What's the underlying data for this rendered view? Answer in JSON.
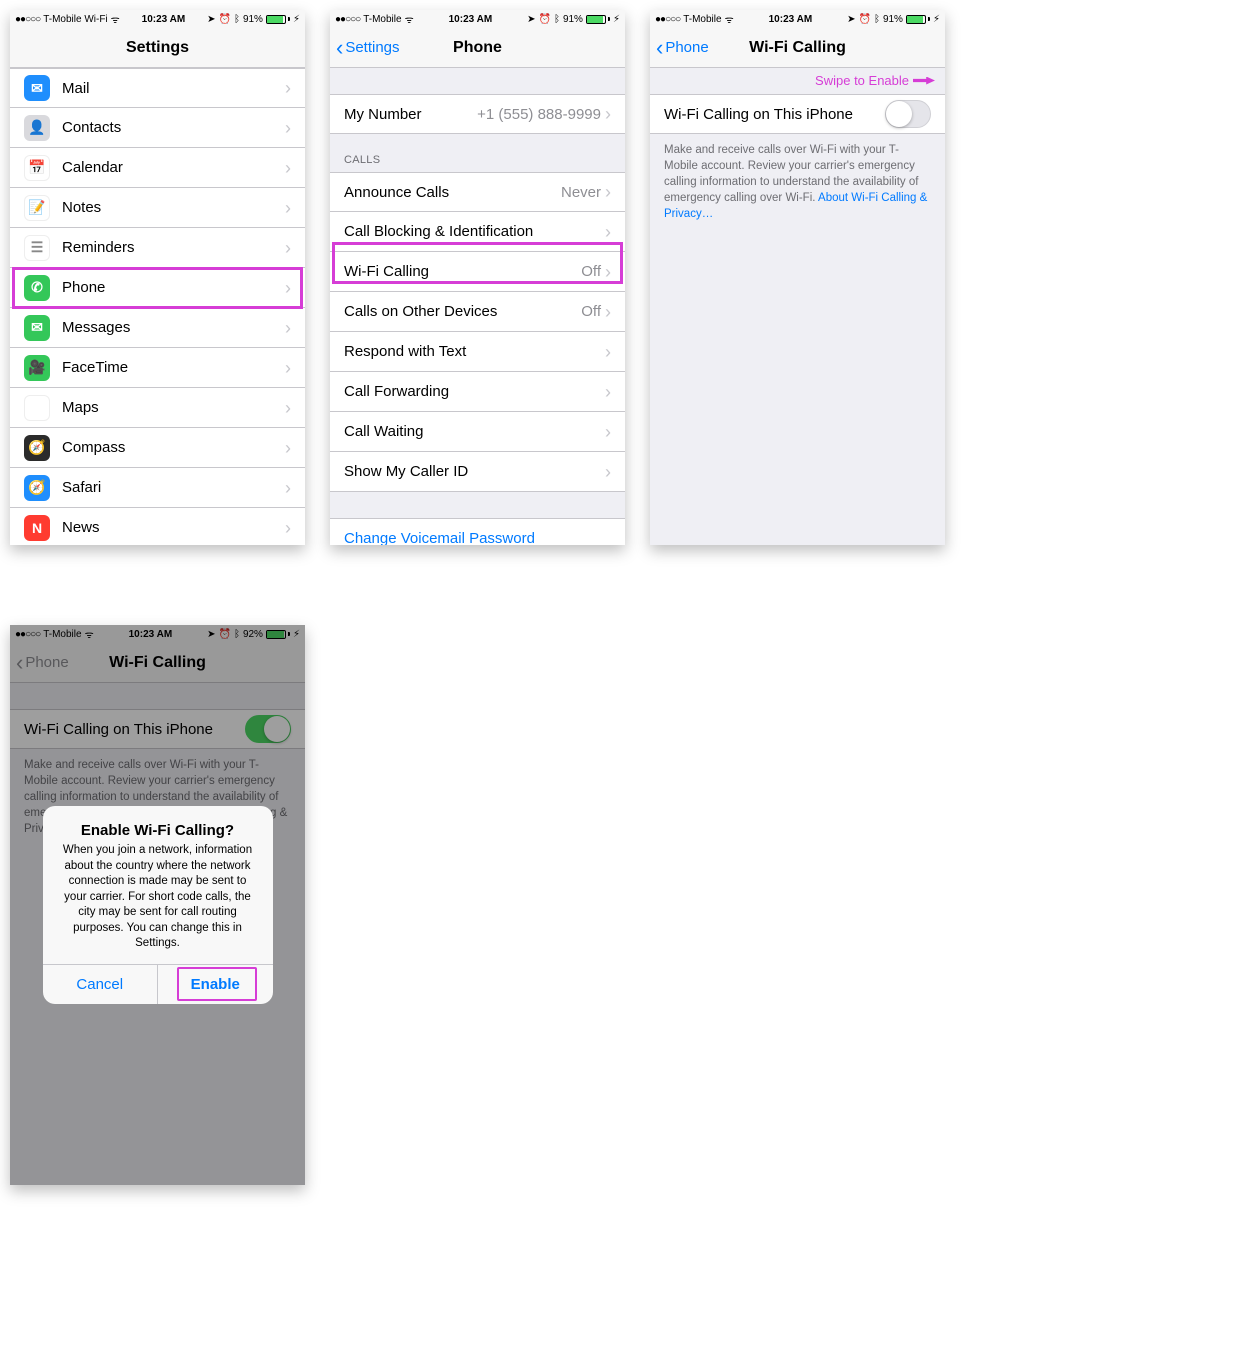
{
  "status": {
    "signal": "●●○○○",
    "carrier": "T-Mobile",
    "carrier_wifi": "T-Mobile Wi-Fi",
    "wifi_glyph": "ᯤ",
    "time": "10:23 AM",
    "loc_glyph": "➤",
    "alarm_glyph": "⏰",
    "bt_glyph": "ᛒ",
    "battery_pct": "91%",
    "battery_pct_alt": "92%",
    "bolt": "⚡︎"
  },
  "screen1": {
    "title": "Settings",
    "items": [
      {
        "label": "Mail",
        "icon": "✉︎",
        "bg": "#1f8efd"
      },
      {
        "label": "Contacts",
        "icon": "👤",
        "bg": "#d9d9dd"
      },
      {
        "label": "Calendar",
        "icon": "📅",
        "bg": "#ffffff"
      },
      {
        "label": "Notes",
        "icon": "📝",
        "bg": "#ffffff"
      },
      {
        "label": "Reminders",
        "icon": "☰",
        "bg": "#ffffff"
      },
      {
        "label": "Phone",
        "icon": "✆",
        "bg": "#34c759"
      },
      {
        "label": "Messages",
        "icon": "✉︎",
        "bg": "#34c759"
      },
      {
        "label": "FaceTime",
        "icon": "🎥",
        "bg": "#34c759"
      },
      {
        "label": "Maps",
        "icon": "🗺",
        "bg": "#ffffff"
      },
      {
        "label": "Compass",
        "icon": "🧭",
        "bg": "#2b2b2b"
      },
      {
        "label": "Safari",
        "icon": "🧭",
        "bg": "#1f8efd"
      },
      {
        "label": "News",
        "icon": "N",
        "bg": "#ff3b30"
      }
    ]
  },
  "screen2": {
    "back": "Settings",
    "title": "Phone",
    "mynumber_label": "My Number",
    "mynumber_value": "+1 (555) 888-9999",
    "calls_header": "CALLS",
    "rows": [
      {
        "label": "Announce Calls",
        "value": "Never"
      },
      {
        "label": "Call Blocking & Identification",
        "value": ""
      },
      {
        "label": "Wi-Fi Calling",
        "value": "Off"
      },
      {
        "label": "Calls on Other Devices",
        "value": "Off"
      },
      {
        "label": "Respond with Text",
        "value": ""
      },
      {
        "label": "Call Forwarding",
        "value": ""
      },
      {
        "label": "Call Waiting",
        "value": ""
      },
      {
        "label": "Show My Caller ID",
        "value": ""
      }
    ],
    "voicemail": "Change Voicemail Password"
  },
  "screen3": {
    "back": "Phone",
    "title": "Wi-Fi Calling",
    "hint": "Swipe to Enable",
    "toggle_label": "Wi-Fi Calling on This iPhone",
    "footer": "Make and receive calls over Wi-Fi with your T-Mobile account. Review your carrier's emergency calling information to understand the availability of emergency calling over Wi-Fi. ",
    "footer_link": "About Wi-Fi Calling & Privacy…"
  },
  "screen4": {
    "back": "Phone",
    "title": "Wi-Fi Calling",
    "toggle_label": "Wi-Fi Calling on This iPhone",
    "footer": "Make and receive calls over Wi-Fi with your T-Mobile account. Review your carrier's emergency calling information to understand the availability of emergency calling over Wi-Fi. About Wi-Fi Calling & Privacy…",
    "alert_title": "Enable Wi-Fi Calling?",
    "alert_msg": "When you join a network, information about the country where the network connection is made may be sent to your carrier. For short code calls, the city may be sent for call routing purposes. You can change this in Settings.",
    "cancel": "Cancel",
    "enable": "Enable"
  }
}
